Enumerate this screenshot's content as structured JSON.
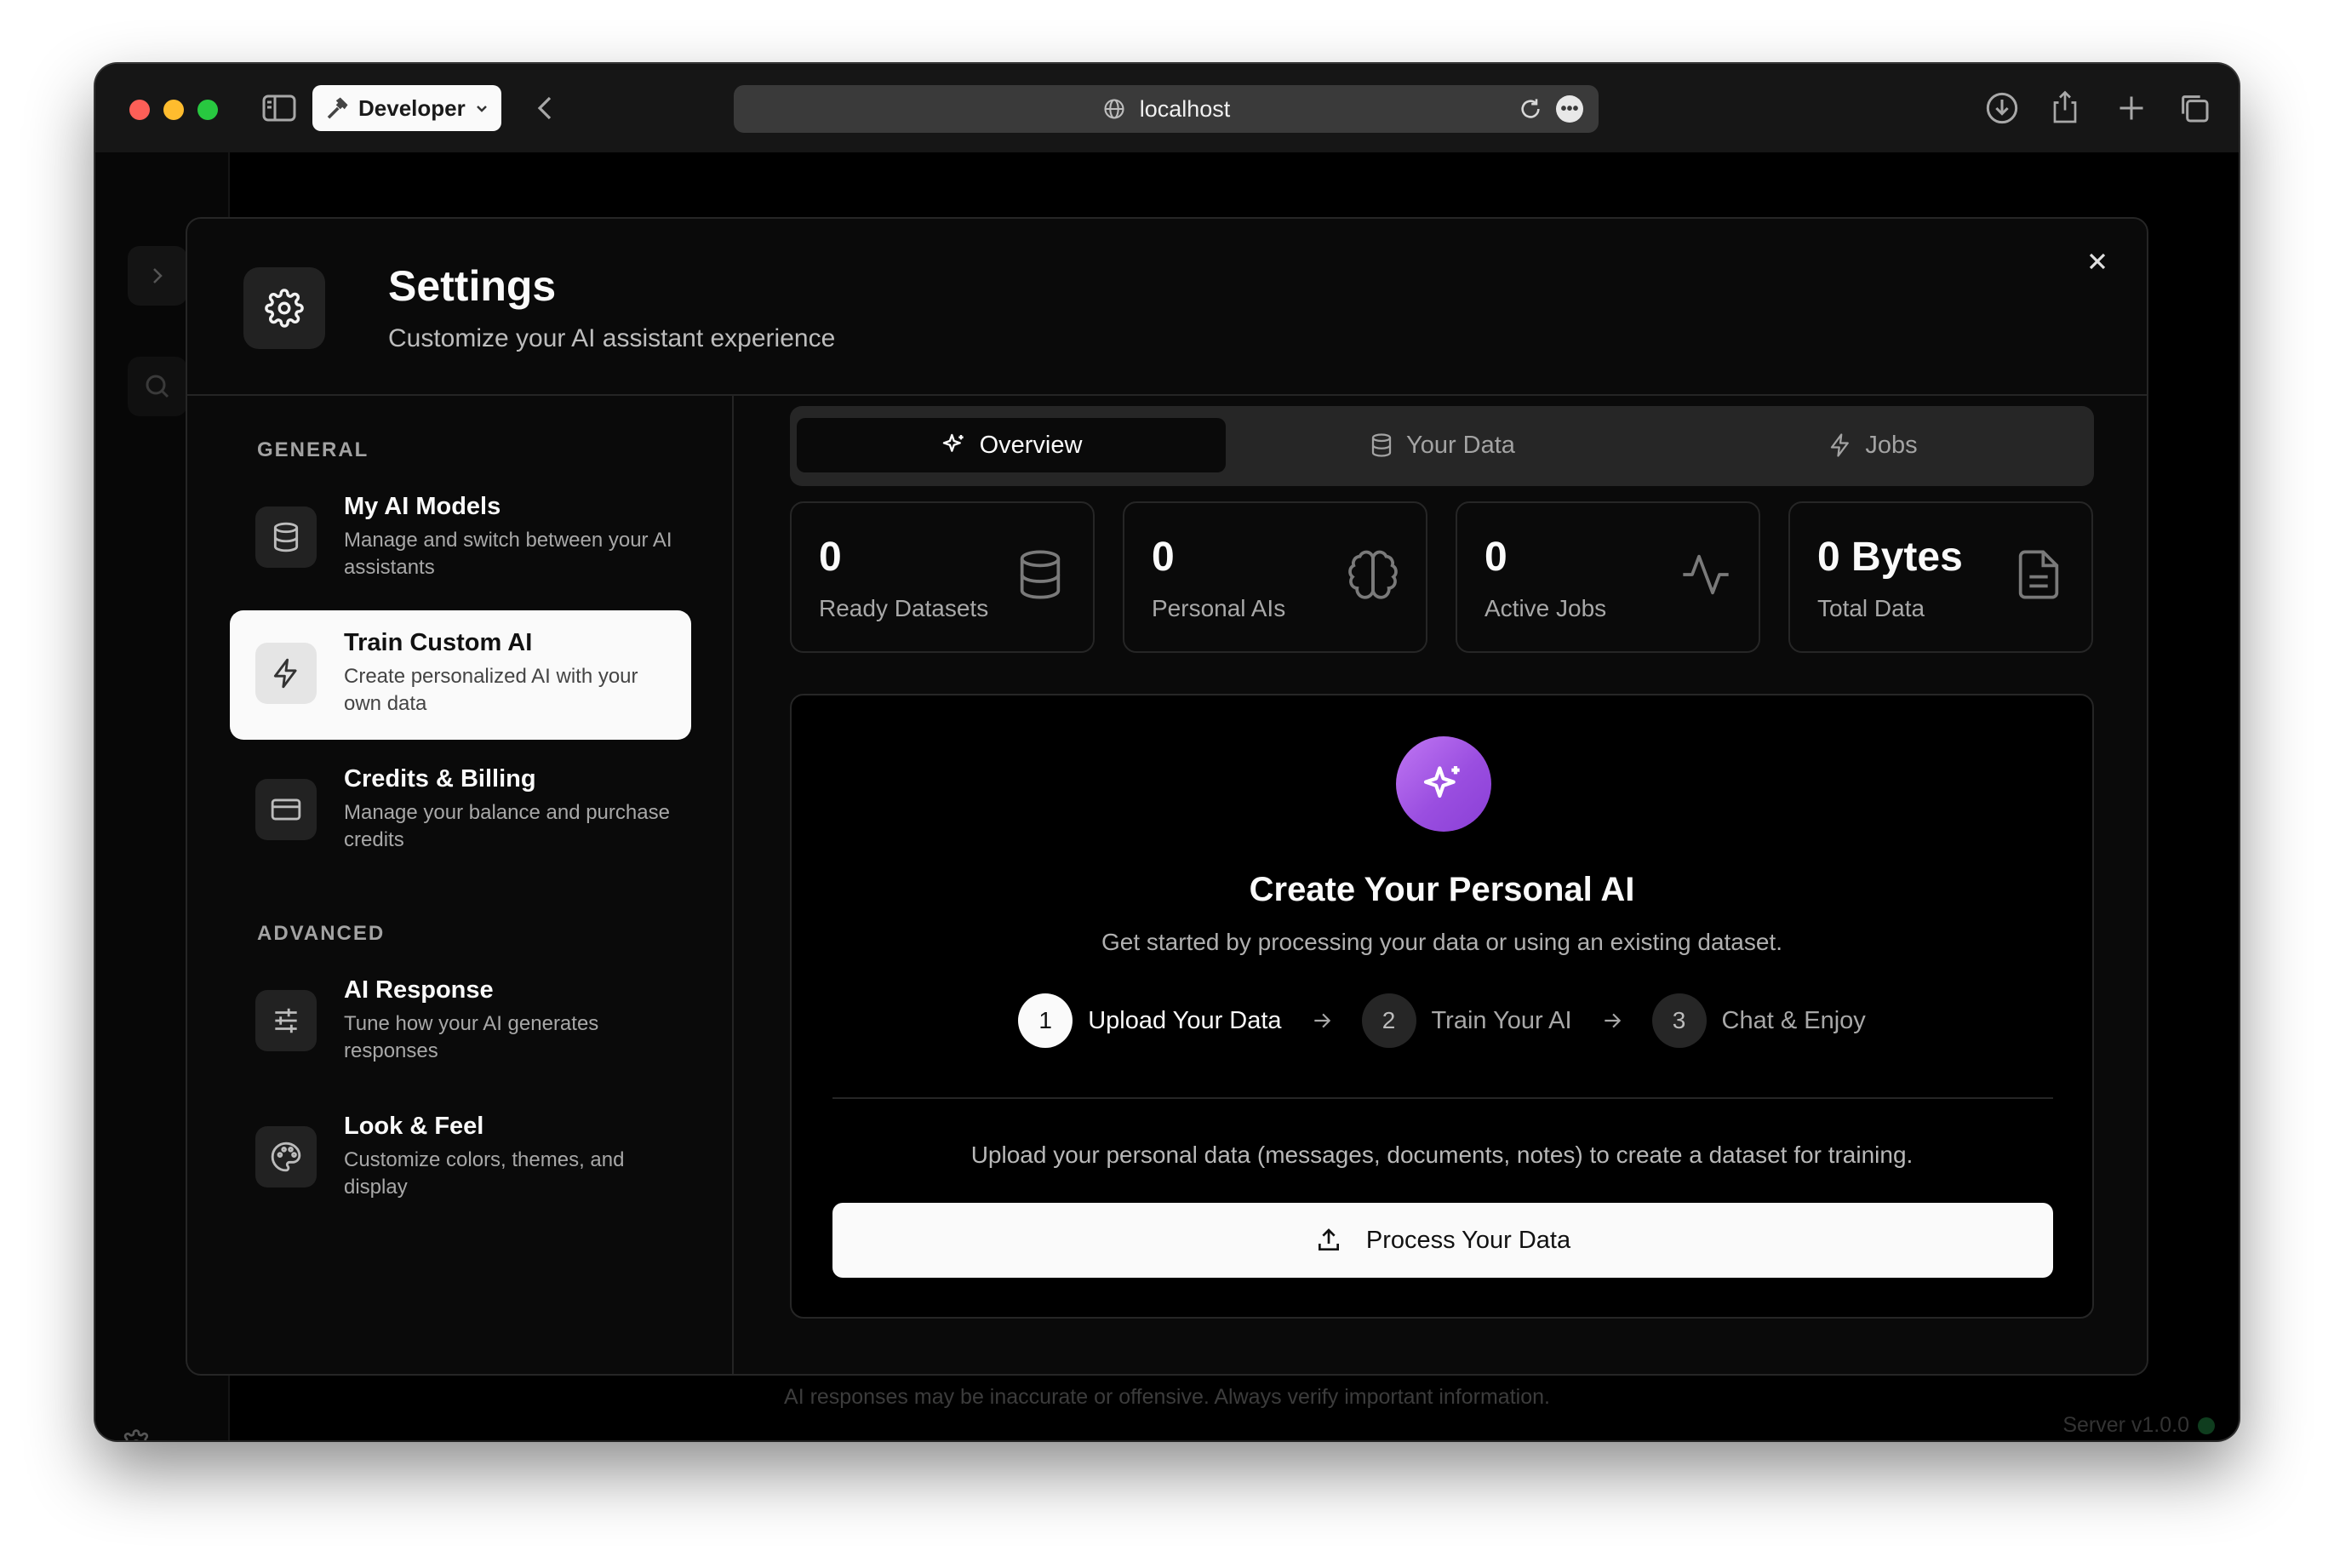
{
  "browser": {
    "profile_label": "Developer",
    "url": "localhost"
  },
  "page": {
    "disclaimer": "AI responses may be inaccurate or offensive. Always verify important information.",
    "server_version": "Server v1.0.0"
  },
  "modal": {
    "title": "Settings",
    "subtitle": "Customize your AI assistant experience",
    "nav": {
      "general_heading": "GENERAL",
      "advanced_heading": "ADVANCED",
      "items": [
        {
          "title": "My AI Models",
          "desc": "Manage and switch between your AI assistants",
          "icon": "database-icon"
        },
        {
          "title": "Train Custom AI",
          "desc": "Create personalized AI with your own data",
          "icon": "lightning-icon",
          "active": true
        },
        {
          "title": "Credits & Billing",
          "desc": "Manage your balance and purchase credits",
          "icon": "credit-card-icon"
        },
        {
          "title": "AI Response",
          "desc": "Tune how your AI generates responses",
          "icon": "sliders-icon"
        },
        {
          "title": "Look & Feel",
          "desc": "Customize colors, themes, and display",
          "icon": "palette-icon"
        }
      ]
    },
    "tabs": [
      {
        "label": "Overview",
        "icon": "sparkle-icon",
        "active": true
      },
      {
        "label": "Your Data",
        "icon": "database-icon"
      },
      {
        "label": "Jobs",
        "icon": "lightning-icon"
      }
    ],
    "stats": [
      {
        "value": "0",
        "label": "Ready Datasets",
        "icon": "database-icon"
      },
      {
        "value": "0",
        "label": "Personal AIs",
        "icon": "brain-icon"
      },
      {
        "value": "0",
        "label": "Active Jobs",
        "icon": "activity-icon"
      },
      {
        "value": "0 Bytes",
        "label": "Total Data",
        "icon": "file-text-icon"
      }
    ],
    "panel": {
      "title": "Create Your Personal AI",
      "subtitle": "Get started by processing your data or using an existing dataset.",
      "steps": [
        {
          "num": "1",
          "label": "Upload Your Data",
          "active": true
        },
        {
          "num": "2",
          "label": "Train Your AI"
        },
        {
          "num": "3",
          "label": "Chat & Enjoy"
        }
      ],
      "note": "Upload your personal data (messages, documents, notes) to create a dataset for training.",
      "button_label": "Process Your Data"
    }
  },
  "colors": {
    "accent_gradient_start": "#c077f3",
    "accent_gradient_end": "#8a3fd6",
    "modal_bg": "#0a0a0a",
    "active_nav_bg": "#fafafa"
  }
}
